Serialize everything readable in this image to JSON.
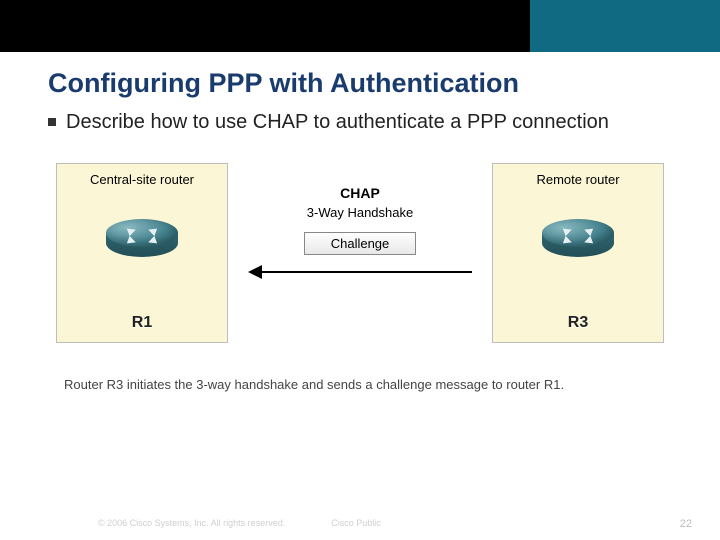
{
  "header": {
    "title": "Configuring PPP with Authentication"
  },
  "bullet": {
    "text": "Describe how to use CHAP to authenticate a PPP connection"
  },
  "diagram": {
    "left_panel": {
      "label": "Central-site router",
      "router_name": "R1"
    },
    "right_panel": {
      "label": "Remote router",
      "router_name": "R3"
    },
    "center": {
      "title": "CHAP",
      "subtitle": "3-Way Handshake",
      "step_label": "Challenge"
    },
    "caption": "Router R3 initiates the 3-way handshake and sends a challenge message to router R1."
  },
  "footer": {
    "copyright": "© 2006 Cisco Systems, Inc. All rights reserved.",
    "classification": "Cisco Public",
    "page": "22"
  }
}
